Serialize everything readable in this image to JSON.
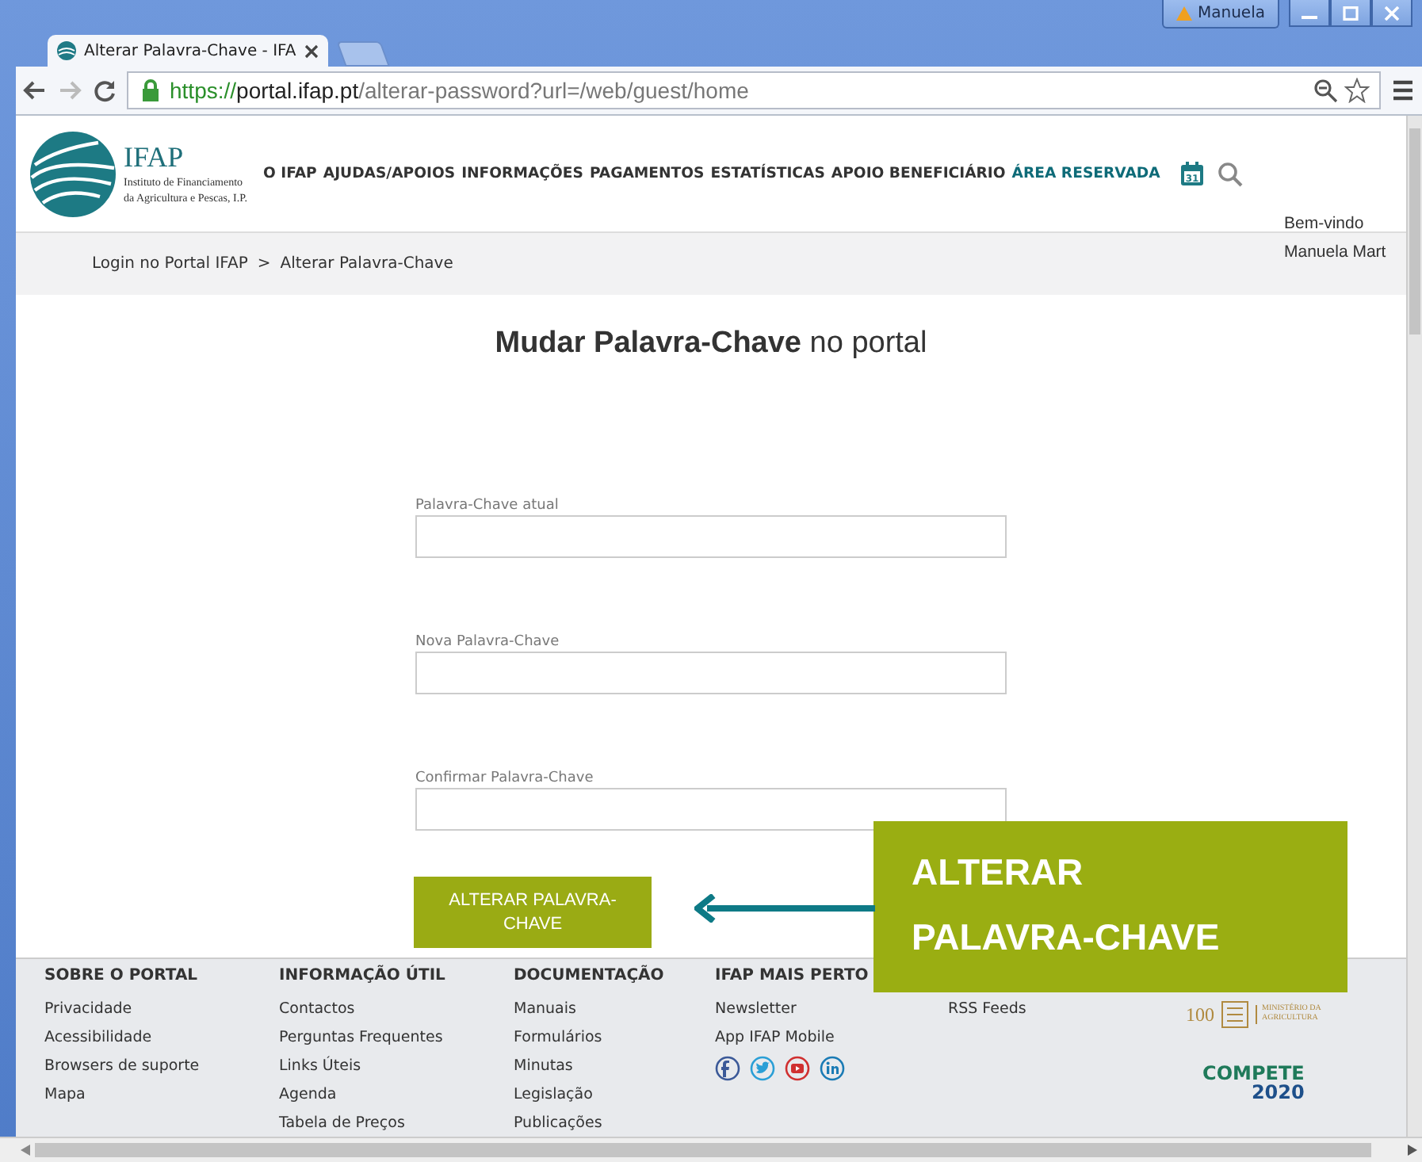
{
  "browser": {
    "tab_title": "Alterar Palavra-Chave - IFA",
    "profile_name": "Manuela",
    "url": {
      "scheme": "https://",
      "host": "portal.ifap.pt",
      "path": "/alterar-password?url=/web/guest/home"
    }
  },
  "header": {
    "logo": {
      "name": "IFAP",
      "subtitle": [
        "Instituto de Financiamento",
        "da Agricultura e Pescas, I.P."
      ]
    },
    "nav": [
      {
        "label": "O IFAP",
        "color": "#333333"
      },
      {
        "label": "AJUDAS/APOIOS",
        "color": "#333333"
      },
      {
        "label": "INFORMAÇÕES",
        "color": "#333333"
      },
      {
        "label": "PAGAMENTOS",
        "color": "#333333"
      },
      {
        "label": "ESTATÍSTICAS",
        "color": "#333333"
      },
      {
        "label": "APOIO BENEFICIÁRIO",
        "color": "#333333"
      },
      {
        "label": "ÁREA RESERVADA",
        "color": "#0e6b78"
      }
    ],
    "calendar_day": "31",
    "welcome": [
      "Bem-vindo",
      "Manuela Mart"
    ]
  },
  "breadcrumb": {
    "items": [
      "Login no Portal IFAP",
      "Alterar Palavra-Chave"
    ],
    "separator": ">"
  },
  "form": {
    "title": "**Mudar Palavra-Chave** no portal",
    "fields": [
      {
        "label": "Palavra-Chave atual"
      },
      {
        "label": "Nova Palavra-Chave"
      },
      {
        "label": "Confirmar Palavra-Chave"
      }
    ],
    "submit": "ALTERAR PALAVRA-CHAVE"
  },
  "footer": {
    "columns": [
      {
        "heading": "SOBRE O PORTAL",
        "links": [
          "Privacidade",
          "Acessibilidade",
          "Browsers de suporte",
          "Mapa"
        ]
      },
      {
        "heading": "INFORMAÇÃO ÚTIL",
        "links": [
          "Contactos",
          "Perguntas Frequentes",
          "Links Úteis",
          "Agenda",
          "Tabela de Preços"
        ]
      },
      {
        "heading": "DOCUMENTAÇÃO",
        "links": [
          "Manuais",
          "Formulários",
          "Minutas",
          "Legislação",
          "Publicações"
        ]
      },
      {
        "heading": "IFAP MAIS PERTO",
        "links": [
          "Newsletter",
          "App IFAP Mobile"
        ],
        "social": [
          {
            "kind": "facebook"
          },
          {
            "kind": "twitter"
          },
          {
            "kind": "youtube"
          },
          {
            "kind": "linkedin"
          }
        ]
      },
      {
        "links": [
          "RSS Feeds"
        ]
      }
    ],
    "centenary": {
      "number": "100",
      "ministry": [
        "MINISTÉRIO DA",
        "AGRICULTURA"
      ]
    },
    "compete": {
      "word": "COMPETE",
      "year": "2020"
    }
  },
  "callout": {
    "lines": [
      "ALTERAR",
      "PALAVRA-CHAVE"
    ]
  }
}
